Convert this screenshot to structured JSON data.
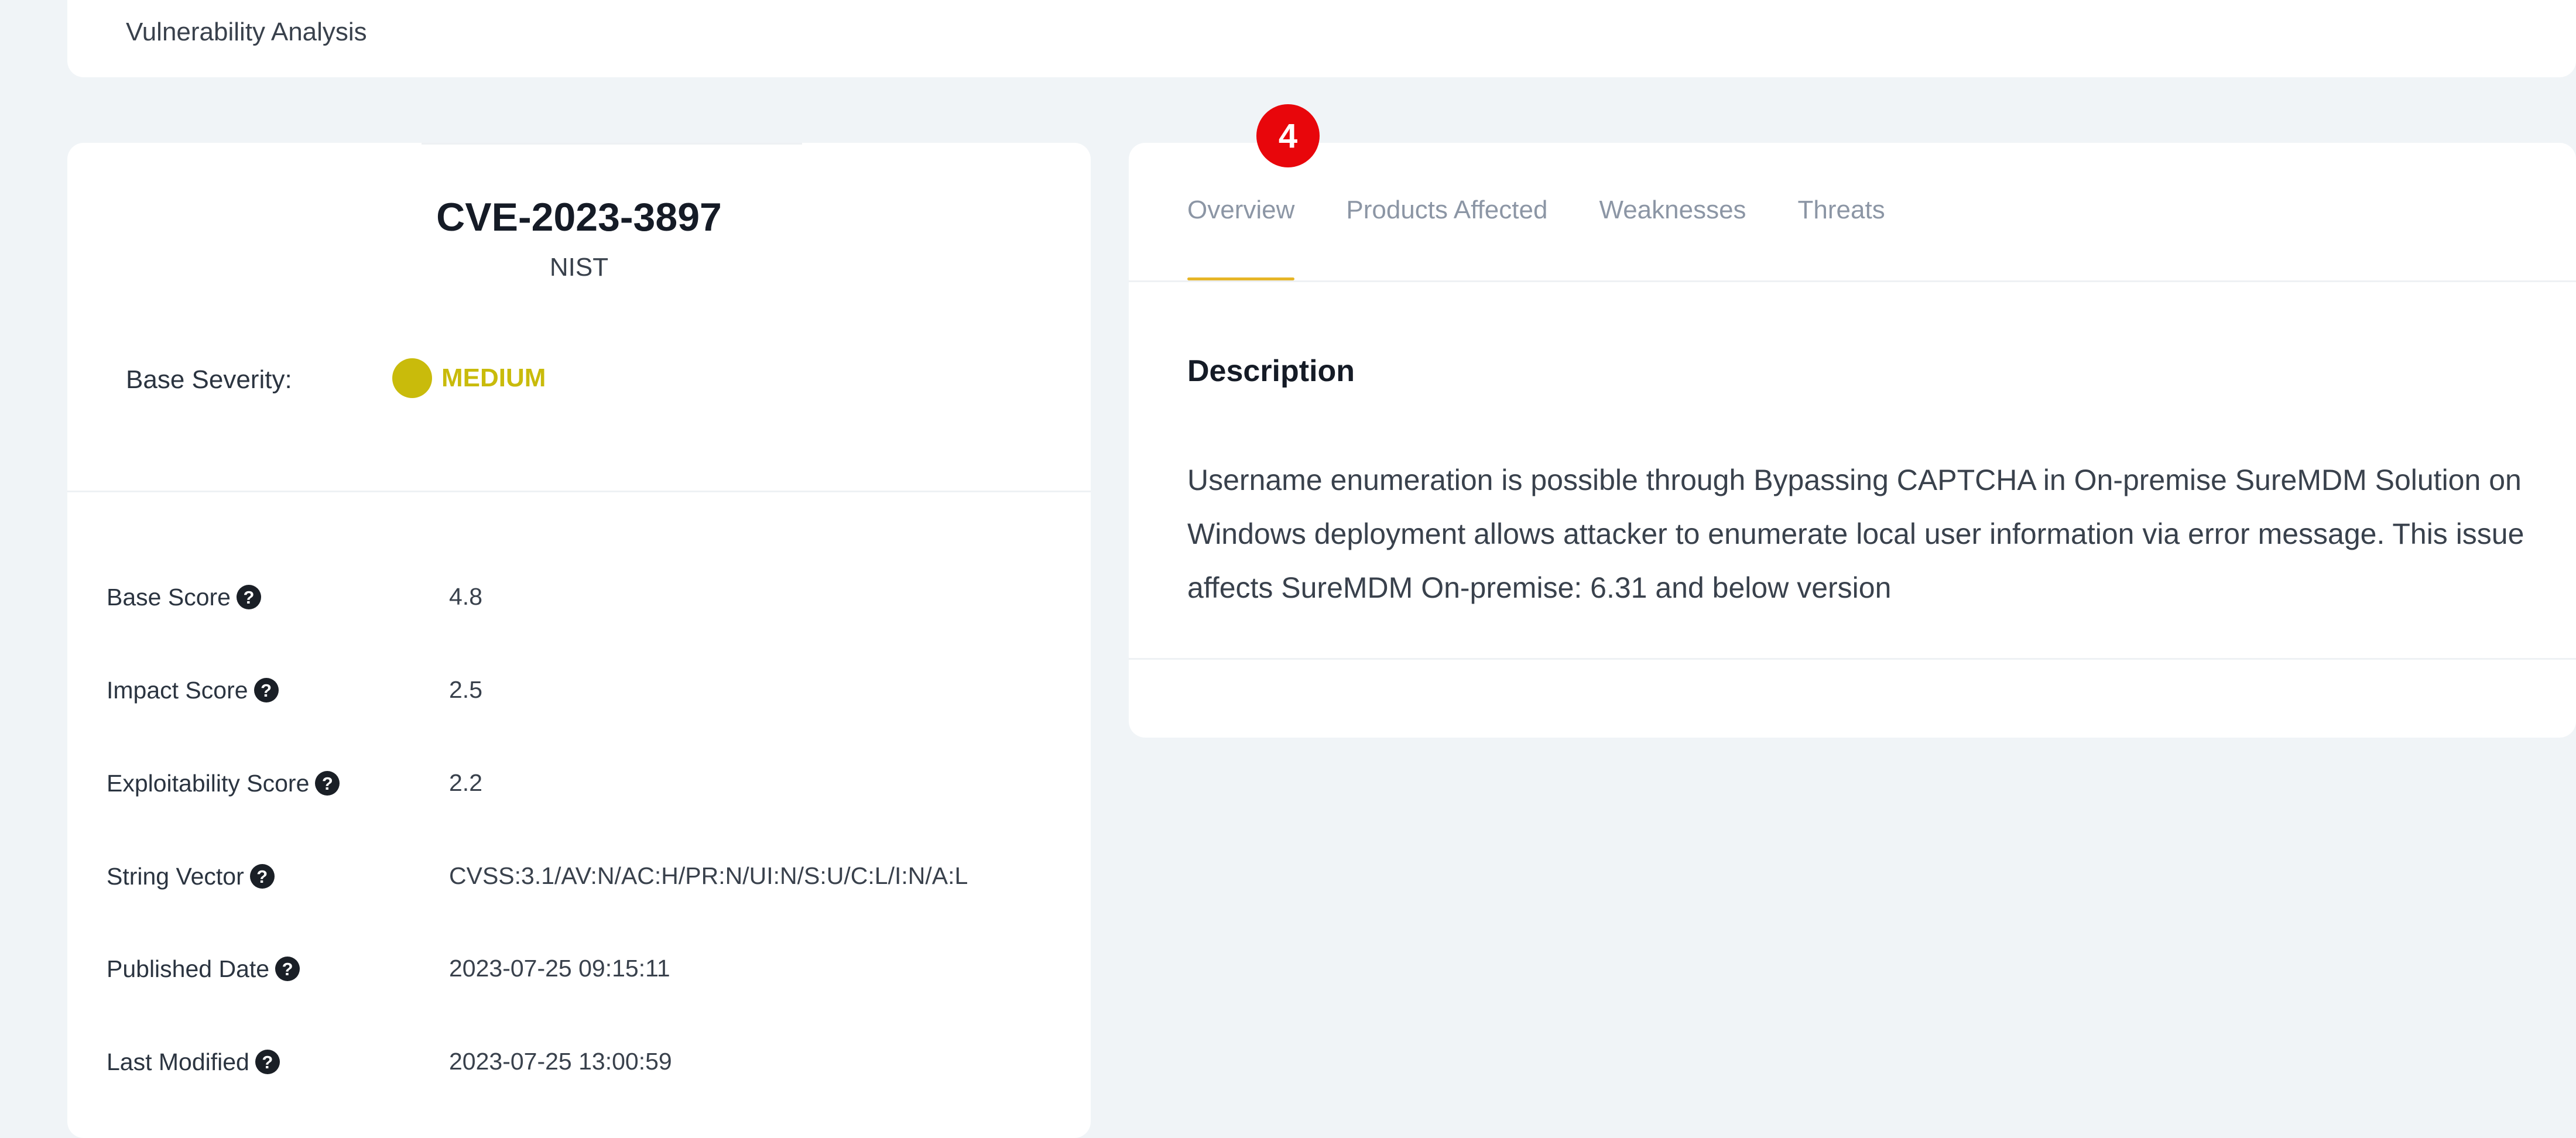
{
  "breadcrumb": {
    "title": "Vulnerability Analysis"
  },
  "summary": {
    "cve_id": "CVE-2023-3897",
    "source": "NIST",
    "severity_label": "Base Severity:",
    "severity_value": "MEDIUM",
    "severity_color": "#c9bb0b"
  },
  "metrics": [
    {
      "label": "Base Score",
      "value": "4.8"
    },
    {
      "label": "Impact Score",
      "value": "2.5"
    },
    {
      "label": "Exploitability Score",
      "value": "2.2"
    },
    {
      "label": "String Vector",
      "value": "CVSS:3.1/AV:N/AC:H/PR:N/UI:N/S:U/C:L/I:N/A:L"
    },
    {
      "label": "Published Date",
      "value": "2023-07-25 09:15:11"
    },
    {
      "label": "Last Modified",
      "value": "2023-07-25 13:00:59"
    }
  ],
  "help_icon": {
    "glyph": "?"
  },
  "tabs": [
    {
      "label": "Overview",
      "active": true
    },
    {
      "label": "Products Affected",
      "active": false
    },
    {
      "label": "Weaknesses",
      "active": false
    },
    {
      "label": "Threats",
      "active": false
    }
  ],
  "overview": {
    "heading": "Description",
    "text": "Username enumeration is possible through Bypassing CAPTCHA in On-premise SureMDM Solution on Windows deployment allows attacker to enumerate local user information via error message. This issue affects SureMDM On-premise: 6.31 and below version"
  },
  "step_badge": {
    "number": "4",
    "color": "#e8060b"
  },
  "colors": {
    "accent": "#e6b527",
    "background": "#f0f4f7",
    "card": "#ffffff"
  }
}
